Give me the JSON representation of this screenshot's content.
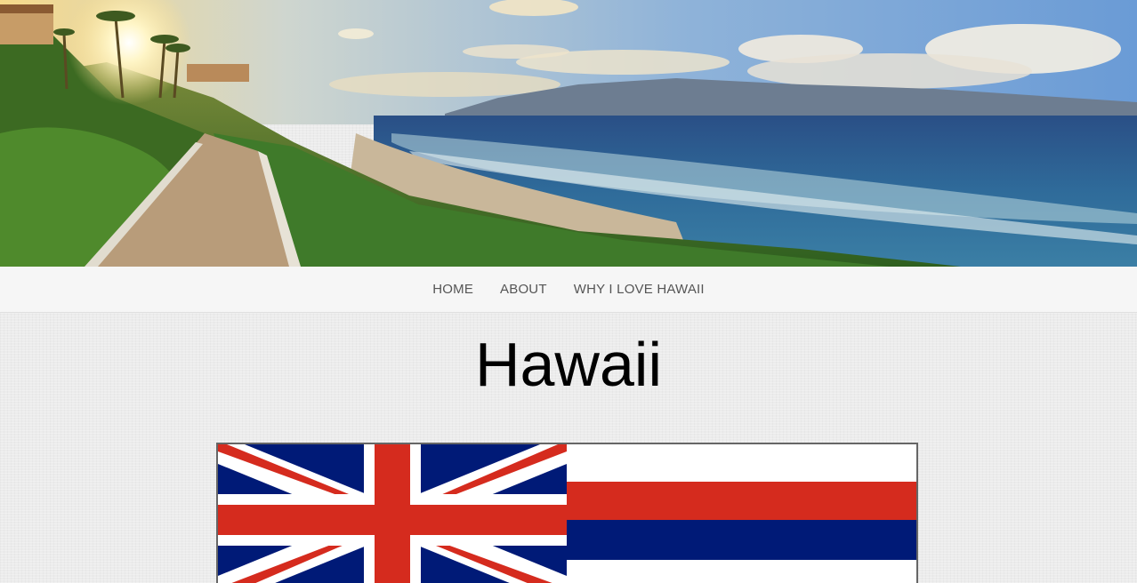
{
  "hero": {
    "image": "maui-coastline-sunset"
  },
  "nav": {
    "items": [
      {
        "label": "HOME"
      },
      {
        "label": "ABOUT"
      },
      {
        "label": "WHY I LOVE HAWAII"
      }
    ]
  },
  "page": {
    "title": "Hawaii"
  },
  "flag": {
    "image": "hawaii-state-flag",
    "colors": {
      "white": "#ffffff",
      "red": "#d52b1e",
      "blue": "#001a77"
    }
  },
  "colors": {
    "nav_bg": "#f6f6f6",
    "nav_text": "#555555",
    "page_bg": "#ececec",
    "title": "#000000"
  }
}
